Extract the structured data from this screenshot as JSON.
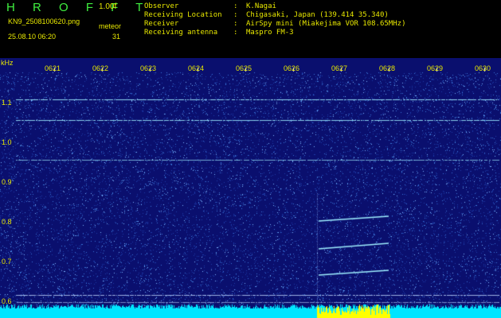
{
  "header": {
    "brand": "H R O F F T",
    "version": "1.00f",
    "filename": "KN9_2508100620.png",
    "timestamp": "25.08.10 06:20",
    "meteor_label": "meteor",
    "meteor_count": "31",
    "info": [
      {
        "key": "Observer",
        "value": "K.Nagai"
      },
      {
        "key": "Receiving Location",
        "value": "Chigasaki, Japan (139.414 35.340)"
      },
      {
        "key": "Receiver",
        "value": "AirSpy mini (Miakejima VOR 108.65MHz)"
      },
      {
        "key": "Receiving antenna",
        "value": "Maspro FM-3"
      }
    ]
  },
  "spectrogram": {
    "y_unit": "kHz",
    "y_ticks": [
      "1.1",
      "1.0",
      "0.9",
      "0.8",
      "0.7",
      "0.6"
    ],
    "time_ticks": [
      "0621",
      "0622",
      "0623",
      "0624",
      "0625",
      "0626",
      "0627",
      "0628",
      "0629",
      "0630"
    ],
    "colors": {
      "background": "#0a0f6e",
      "noise": "#3a78d8",
      "signal": "#9ff0ff",
      "label": "#e8e800",
      "bottom_bar": "#00e5ff",
      "bottom_highlight": "#ffff00"
    }
  }
}
